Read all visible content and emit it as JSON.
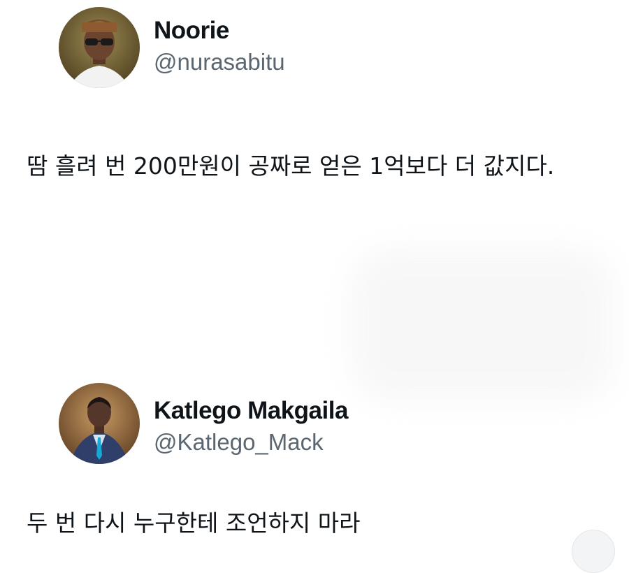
{
  "tweets": [
    {
      "user": {
        "name": "Noorie",
        "handle": "@nurasabitu"
      },
      "text": "땀 흘려 번 200만원이 공짜로 얻은 1억보다 더 값지다."
    },
    {
      "user": {
        "name": "Katlego Makgaila",
        "handle": "@Katlego_Mack"
      },
      "text": "두 번 다시 누구한테 조언하지 마라"
    }
  ],
  "colors": {
    "background": "#ffffff",
    "text": "#0f1419",
    "secondary": "#5b6670"
  }
}
